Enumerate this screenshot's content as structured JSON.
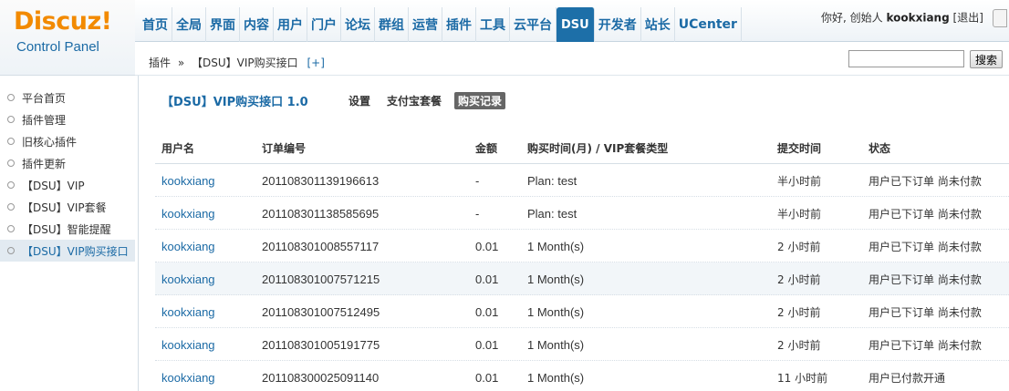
{
  "brand": {
    "logo": "Discuz!",
    "subtitle": "Control Panel"
  },
  "nav": {
    "items": [
      "首页",
      "全局",
      "界面",
      "内容",
      "用户",
      "门户",
      "论坛",
      "群组",
      "运营",
      "插件",
      "工具",
      "云平台",
      "DSU",
      "开发者",
      "站长",
      "UCenter"
    ],
    "active": "DSU"
  },
  "user": {
    "greeting": "你好, 创始人",
    "name": "kookxiang",
    "logout": "[退出]"
  },
  "breadcrumb": {
    "root": "插件",
    "separator": "»",
    "current": "【DSU】VIP购买接口",
    "add": "[+]"
  },
  "search": {
    "button": "搜索",
    "value": ""
  },
  "sidebar": {
    "items": [
      "平台首页",
      "插件管理",
      "旧核心插件",
      "插件更新",
      "【DSU】VIP",
      "【DSU】VIP套餐",
      "【DSU】智能提醒",
      "【DSU】VIP购买接口"
    ],
    "active_index": 7
  },
  "page": {
    "title": "【DSU】VIP购买接口 1.0",
    "tabs": [
      "设置",
      "支付宝套餐",
      "购买记录"
    ],
    "active_tab": "购买记录"
  },
  "table": {
    "headers": [
      "用户名",
      "订单编号",
      "金额",
      "购买时间(月) / VIP套餐类型",
      "提交时间",
      "状态"
    ],
    "rows": [
      [
        "kookxiang",
        "201108301139196613",
        "-",
        "Plan: test",
        "半小时前",
        "用户已下订单 尚未付款"
      ],
      [
        "kookxiang",
        "201108301138585695",
        "-",
        "Plan: test",
        "半小时前",
        "用户已下订单 尚未付款"
      ],
      [
        "kookxiang",
        "201108301008557117",
        "0.01",
        "1 Month(s)",
        "2 小时前",
        "用户已下订单 尚未付款"
      ],
      [
        "kookxiang",
        "201108301007571215",
        "0.01",
        "1 Month(s)",
        "2 小时前",
        "用户已下订单 尚未付款"
      ],
      [
        "kookxiang",
        "201108301007512495",
        "0.01",
        "1 Month(s)",
        "2 小时前",
        "用户已下订单 尚未付款"
      ],
      [
        "kookxiang",
        "201108301005191775",
        "0.01",
        "1 Month(s)",
        "2 小时前",
        "用户已下订单 尚未付款"
      ],
      [
        "kookxiang",
        "201108300025091140",
        "0.01",
        "1 Month(s)",
        "11 小时前",
        "用户已付款开通"
      ]
    ],
    "highlight_row": 3
  }
}
